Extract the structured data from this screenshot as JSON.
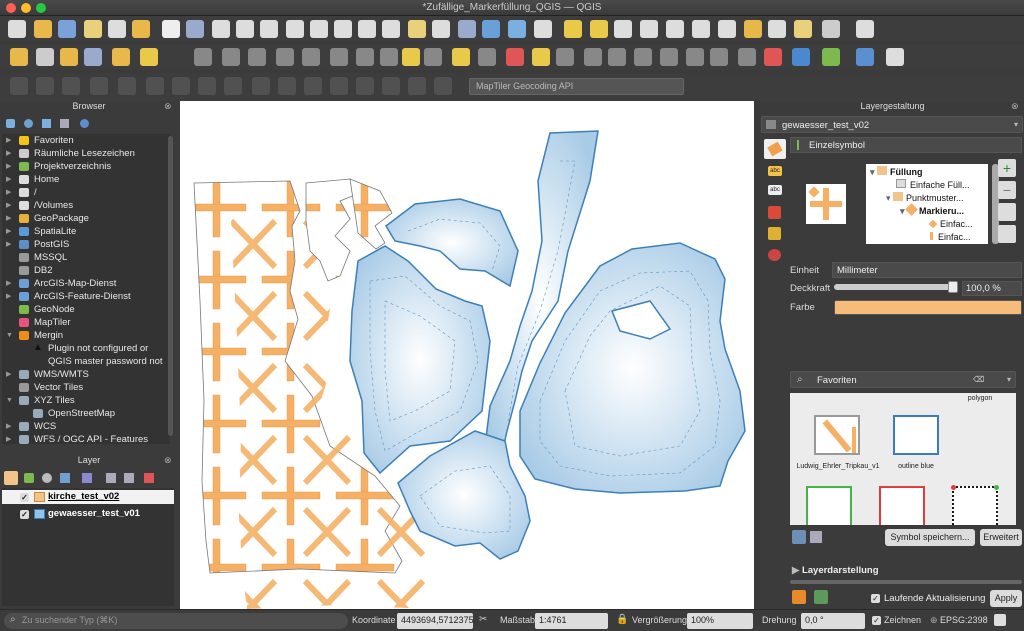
{
  "window": {
    "title": "*Zufällige_Markerfüllung_QGIS — QGIS"
  },
  "geocoder": {
    "placeholder": "MapTiler Geocoding API"
  },
  "browser": {
    "title": "Browser",
    "items": [
      {
        "label": "Favoriten",
        "icon": "star-icon",
        "color": "#f5c518"
      },
      {
        "label": "Räumliche Lesezeichen",
        "icon": "bookmark-icon",
        "color": "#cccccc"
      },
      {
        "label": "Projektverzeichnis",
        "icon": "project-folder-icon",
        "color": "#7cba4f"
      },
      {
        "label": "Home",
        "icon": "home-icon",
        "color": "#dddddd"
      },
      {
        "label": "/",
        "icon": "folder-icon",
        "color": "#dddddd"
      },
      {
        "label": "/Volumes",
        "icon": "folder-icon",
        "color": "#dddddd"
      },
      {
        "label": "GeoPackage",
        "icon": "geopackage-icon",
        "color": "#e8b03a"
      },
      {
        "label": "SpatiaLite",
        "icon": "spatialite-icon",
        "color": "#5a9ad6"
      },
      {
        "label": "PostGIS",
        "icon": "postgis-icon",
        "color": "#5b8fc7"
      },
      {
        "label": "MSSQL",
        "icon": "mssql-icon",
        "color": "#9a9a9a"
      },
      {
        "label": "DB2",
        "icon": "db2-icon",
        "color": "#9a9a9a"
      },
      {
        "label": "ArcGIS-Map-Dienst",
        "icon": "arcgis-icon",
        "color": "#6aa1d8"
      },
      {
        "label": "ArcGIS-Feature-Dienst",
        "icon": "arcgis-icon",
        "color": "#6aa1d8"
      },
      {
        "label": "GeoNode",
        "icon": "geonode-icon",
        "color": "#7cba4f"
      },
      {
        "label": "MapTiler",
        "icon": "maptiler-icon",
        "color": "#e75480"
      },
      {
        "label": "Mergin",
        "icon": "mergin-icon",
        "color": "#f08c1a"
      },
      {
        "label": "Plugin not configured or",
        "icon": "warning-icon",
        "color": "#111111"
      },
      {
        "label": "QGIS master password not",
        "icon": "",
        "color": ""
      },
      {
        "label": "WMS/WMTS",
        "icon": "wms-icon",
        "color": "#9ab"
      },
      {
        "label": "Vector Tiles",
        "icon": "vector-tiles-icon",
        "color": "#999"
      },
      {
        "label": "XYZ Tiles",
        "icon": "xyz-tiles-icon",
        "color": "#9ab"
      },
      {
        "label": "OpenStreetMap",
        "icon": "osm-icon",
        "color": "#9ab"
      },
      {
        "label": "WCS",
        "icon": "wcs-icon",
        "color": "#9ab"
      },
      {
        "label": "WFS / OGC API - Features",
        "icon": "wfs-icon",
        "color": "#9ab"
      }
    ]
  },
  "layers": {
    "title": "Layer",
    "items": [
      {
        "label": "kirche_test_v02",
        "checked": true,
        "selected": true
      },
      {
        "label": "gewaesser_test_v01",
        "checked": true,
        "selected": false
      }
    ]
  },
  "styling": {
    "title": "Layergestaltung",
    "layer_select": "gewaesser_test_v02",
    "renderer": "Einzelsymbol",
    "tree": [
      "Füllung",
      "Einfache Füll...",
      "Punktmuster...",
      "Markieru...",
      "Einfac...",
      "Einfac..."
    ],
    "unit_label": "Einheit",
    "unit_value": "Millimeter",
    "opacity_label": "Deckkraft",
    "opacity_value": "100,0 %",
    "opacity_fraction": 1.0,
    "color_label": "Farbe",
    "color_value": "#f7bb7a",
    "favorites_search": "Favoriten",
    "favorites_group": "polygon",
    "favorites": [
      {
        "label": "Ludwig_Ehrler_Tripkau_v1",
        "border": "#999999"
      },
      {
        "label": "outline blue",
        "border": "#3a7ac9"
      },
      {
        "label": "",
        "border": "#47b347"
      },
      {
        "label": "",
        "border": "#e23b3b"
      },
      {
        "label": "",
        "border": "#1a1a1a"
      }
    ],
    "save_symbol": "Symbol speichern...",
    "advanced": "Erweitert",
    "layer_rendering": "Layerdarstellung",
    "live_update": "Laufende Aktualisierung",
    "apply": "Apply"
  },
  "status": {
    "search_placeholder": "Zu suchender Typ (⌘K)",
    "coord_label": "Koordinate",
    "coord_value": "4493694,5712375",
    "scale_label": "Maßstab",
    "scale_value": "1:4761",
    "magnify_label": "Vergrößerung",
    "magnify_value": "100%",
    "rotation_label": "Drehung",
    "rotation_value": "0,0 °",
    "render_label": "Zeichnen",
    "crs": "EPSG:2398"
  }
}
